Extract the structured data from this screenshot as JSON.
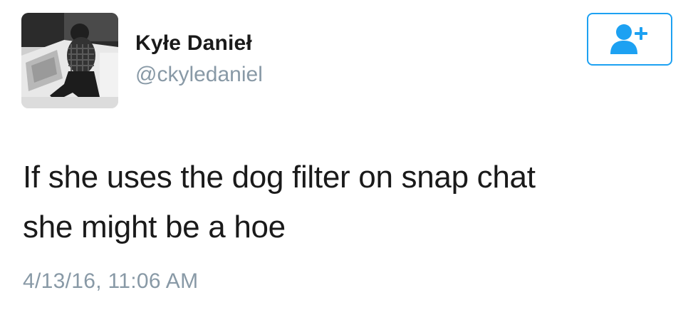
{
  "user": {
    "display_name": "Kyłe Danieł",
    "handle": "@ckyledaniel",
    "avatar_icon": "profile-photo"
  },
  "follow_button": {
    "icon": "add-user-icon",
    "color": "#1da1f2"
  },
  "tweet": {
    "lines": [
      "If she uses the dog filter on snap chat",
      "she might be a hoe"
    ],
    "timestamp": "4/13/16, 11:06 AM"
  },
  "colors": {
    "text": "#1a1a1a",
    "secondary": "#8899a6",
    "accent": "#1da1f2"
  }
}
